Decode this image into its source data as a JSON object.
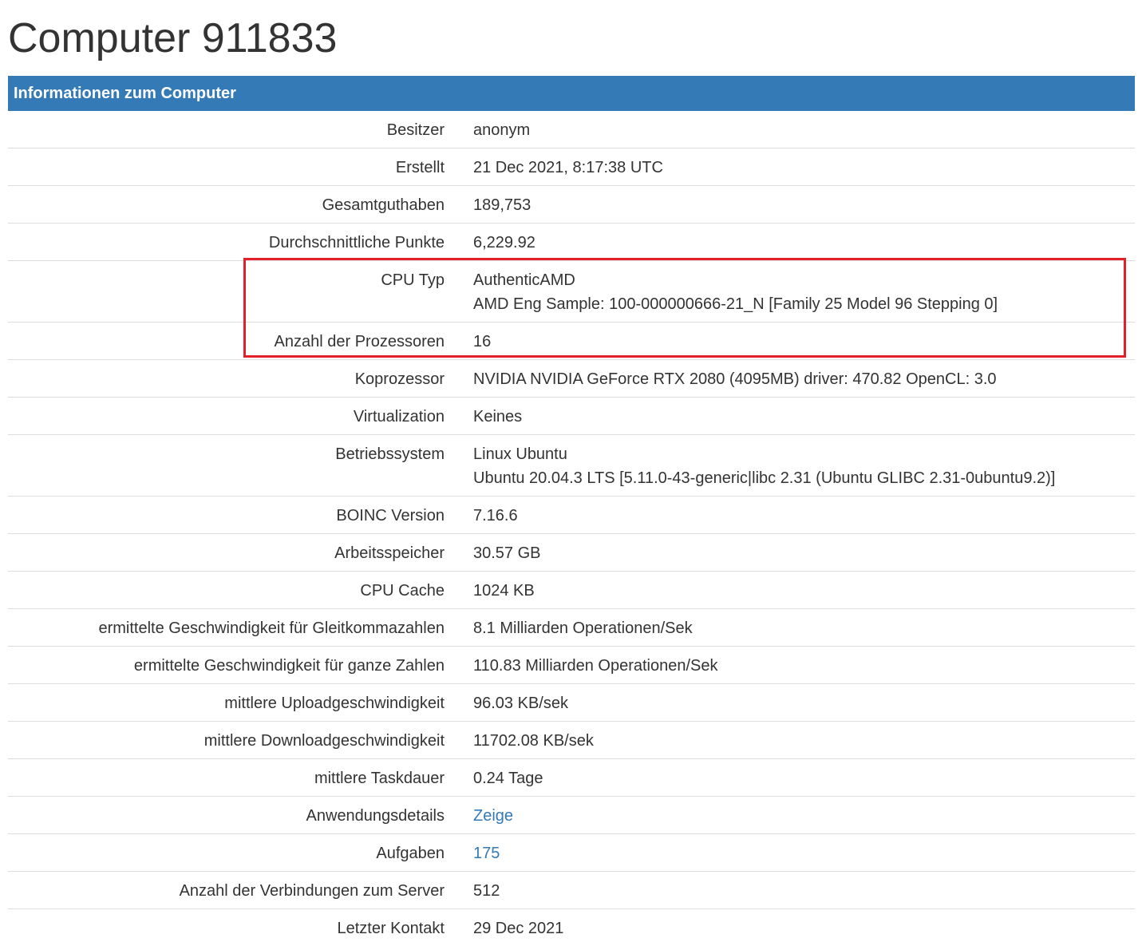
{
  "page": {
    "title": "Computer 911833"
  },
  "panel": {
    "header": "Informationen zum Computer"
  },
  "rows": [
    {
      "label": "Besitzer",
      "value": "anonym"
    },
    {
      "label": "Erstellt",
      "value": "21 Dec 2021, 8:17:38 UTC"
    },
    {
      "label": "Gesamtguthaben",
      "value": "189,753"
    },
    {
      "label": "Durchschnittliche Punkte",
      "value": "6,229.92"
    },
    {
      "label": "CPU Typ",
      "value": "AuthenticAMD",
      "value2": "AMD Eng Sample: 100-000000666-21_N [Family 25 Model 96 Stepping 0]"
    },
    {
      "label": "Anzahl der Prozessoren",
      "value": "16"
    },
    {
      "label": "Koprozessor",
      "value": "NVIDIA NVIDIA GeForce RTX 2080 (4095MB) driver: 470.82 OpenCL: 3.0"
    },
    {
      "label": "Virtualization",
      "value": "Keines"
    },
    {
      "label": "Betriebssystem",
      "value": "Linux Ubuntu",
      "value2": "Ubuntu 20.04.3 LTS [5.11.0-43-generic|libc 2.31 (Ubuntu GLIBC 2.31-0ubuntu9.2)]"
    },
    {
      "label": "BOINC Version",
      "value": "7.16.6"
    },
    {
      "label": "Arbeitsspeicher",
      "value": "30.57 GB"
    },
    {
      "label": "CPU Cache",
      "value": "1024 KB"
    },
    {
      "label": "ermittelte Geschwindigkeit für Gleitkommazahlen",
      "value": "8.1 Milliarden Operationen/Sek"
    },
    {
      "label": "ermittelte Geschwindigkeit für ganze Zahlen",
      "value": "110.83 Milliarden Operationen/Sek"
    },
    {
      "label": "mittlere Uploadgeschwindigkeit",
      "value": "96.03 KB/sek"
    },
    {
      "label": "mittlere Downloadgeschwindigkeit",
      "value": "11702.08 KB/sek"
    },
    {
      "label": "mittlere Taskdauer",
      "value": "0.24 Tage"
    },
    {
      "label": "Anwendungsdetails",
      "value": "Zeige"
    },
    {
      "label": "Aufgaben",
      "value": "175"
    },
    {
      "label": "Anzahl der Verbindungen zum Server",
      "value": "512"
    },
    {
      "label": "Letzter Kontakt",
      "value": "29 Dec 2021"
    }
  ],
  "colors": {
    "header_bg": "#337ab7",
    "link": "#337ab7",
    "highlight": "#e3202a",
    "divider": "#dddddd"
  }
}
